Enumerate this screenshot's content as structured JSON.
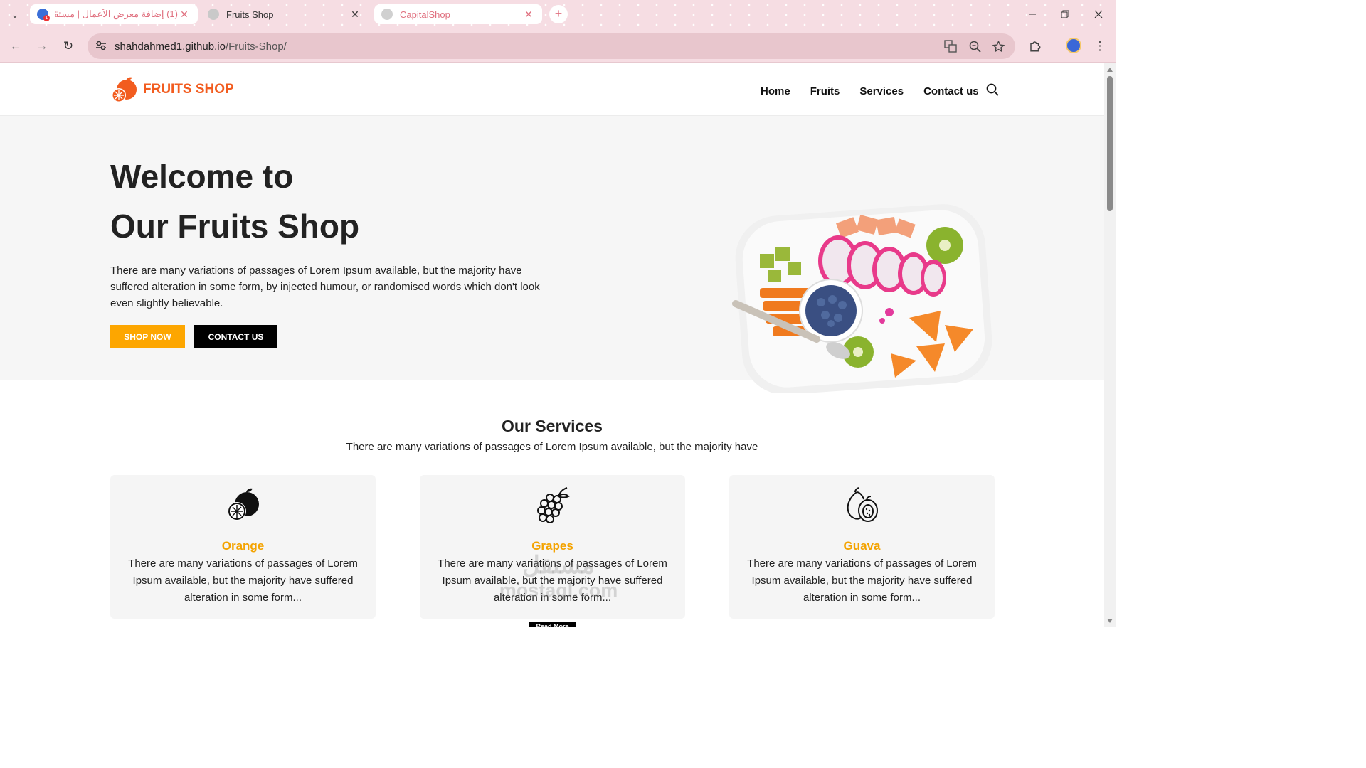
{
  "browser": {
    "tabs": [
      {
        "title": "(1) إضافة معرض الأعمال | مستقل",
        "active": false
      },
      {
        "title": "Fruits Shop",
        "active": true
      },
      {
        "title": "CapitalShop",
        "active": false
      }
    ],
    "url_host": "shahdahmed1.github.io",
    "url_path": "/Fruits-Shop/",
    "tab_close_glyph": "✕",
    "new_tab_glyph": "+",
    "colors": {
      "chrome_bg": "#f6dde3",
      "omnibox_bg": "#e8c6cd",
      "accent_tab_text": "#e0707f"
    }
  },
  "site": {
    "brand": "FRUITS SHOP",
    "brand_color": "#f25c1f",
    "nav": [
      "Home",
      "Fruits",
      "Services",
      "Contact us"
    ],
    "hero": {
      "title_line_1": "Welcome to",
      "title_line_2": "Our Fruits Shop",
      "text": "There are many variations of passages of Lorem Ipsum available, but the majority have suffered alteration in some form, by injected humour, or randomised words which don't look even slightly believable.",
      "shop_button": "SHOP NOW",
      "contact_button": "CONTACT US",
      "accent_color": "#fda600"
    },
    "services": {
      "title": "Our Services",
      "subtitle": "There are many variations of passages of Lorem Ipsum available, but the majority have",
      "cards": [
        {
          "name": "Orange",
          "icon": "orange-icon",
          "text": "There are many variations of passages of Lorem Ipsum available, but the majority have suffered alteration in some form..."
        },
        {
          "name": "Grapes",
          "icon": "grapes-icon",
          "text": "There are many variations of passages of Lorem Ipsum available, but the majority have suffered alteration in some form..."
        },
        {
          "name": "Guava",
          "icon": "guava-icon",
          "text": "There are many variations of passages of Lorem Ipsum available, but the majority have suffered alteration in some form..."
        }
      ],
      "read_more": "Read More"
    },
    "watermark": {
      "line_1": "مستقل",
      "line_2": "mostaql.com"
    }
  }
}
